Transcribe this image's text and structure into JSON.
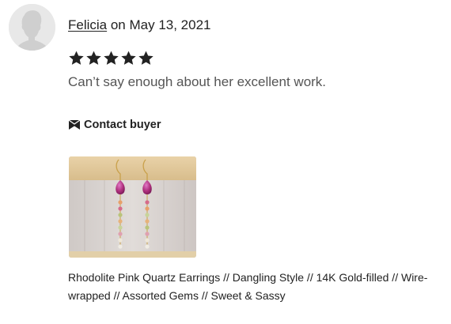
{
  "review": {
    "author": "Felicia",
    "date_prefix": " on ",
    "date": "May 13, 2021",
    "rating": 5,
    "text": "Can’t say enough about her excellent work."
  },
  "contact": {
    "label": "Contact buyer",
    "icon": "envelope-icon"
  },
  "listing": {
    "title": "Rhodolite Pink Quartz Earrings // Dangling Style // 14K Gold-filled // Wire-wrapped // Assorted Gems // Sweet & Sassy",
    "image": "earrings-photo"
  },
  "colors": {
    "text": "#222222",
    "muted": "#555555",
    "star": "#222222",
    "avatar_bg": "#e9e9e9"
  }
}
